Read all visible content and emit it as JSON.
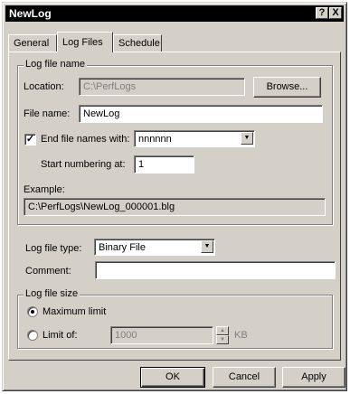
{
  "window": {
    "title": "NewLog",
    "help_btn": "?",
    "close_btn": "X"
  },
  "tabs": [
    {
      "label": "General",
      "active": false
    },
    {
      "label": "Log Files",
      "active": true
    },
    {
      "label": "Schedule",
      "active": false
    }
  ],
  "log_file_name": {
    "group_label": "Log file name",
    "location_label": "Location:",
    "location_value": "C:\\PerfLogs",
    "browse_label": "Browse...",
    "file_name_label": "File name:",
    "file_name_value": "NewLog",
    "end_file_names_label": "End file names with:",
    "end_file_names_checked": true,
    "end_file_names_value": "nnnnnn",
    "start_numbering_label": "Start numbering at:",
    "start_numbering_value": "1",
    "example_label": "Example:",
    "example_value": "C:\\PerfLogs\\NewLog_000001.blg"
  },
  "log_file_type": {
    "label": "Log file type:",
    "value": "Binary File"
  },
  "comment": {
    "label": "Comment:",
    "value": ""
  },
  "log_file_size": {
    "group_label": "Log file size",
    "maximum_limit_label": "Maximum limit",
    "limit_of_label": "Limit of:",
    "limit_value": "1000",
    "unit": "KB",
    "selected": "maximum_limit"
  },
  "buttons": {
    "ok": "OK",
    "cancel": "Cancel",
    "apply": "Apply"
  }
}
